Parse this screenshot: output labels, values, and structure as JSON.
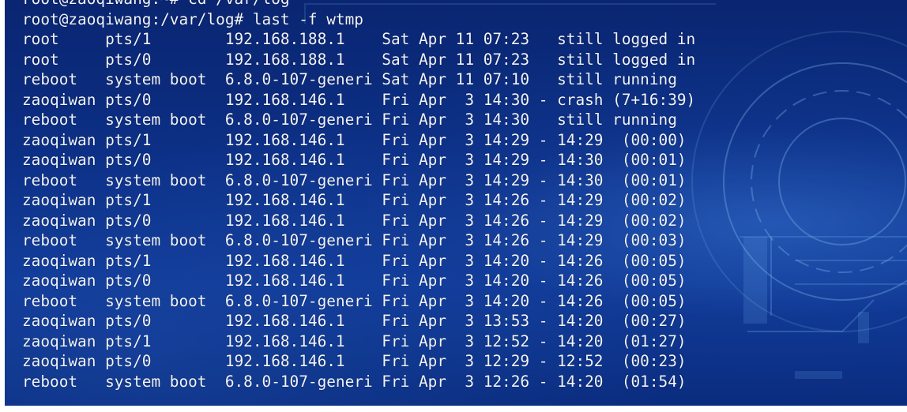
{
  "terminal": {
    "lines": [
      "root@zaoqiwang:~# cd /var/log",
      "root@zaoqiwang:/var/log# last -f wtmp",
      "root     pts/1        192.168.188.1    Sat Apr 11 07:23   still logged in",
      "root     pts/0        192.168.188.1    Sat Apr 11 07:23   still logged in",
      "reboot   system boot  6.8.0-107-generi Sat Apr 11 07:10   still running",
      "zaoqiwan pts/0        192.168.146.1    Fri Apr  3 14:30 - crash (7+16:39)",
      "reboot   system boot  6.8.0-107-generi Fri Apr  3 14:30   still running",
      "zaoqiwan pts/1        192.168.146.1    Fri Apr  3 14:29 - 14:29  (00:00)",
      "zaoqiwan pts/0        192.168.146.1    Fri Apr  3 14:29 - 14:30  (00:01)",
      "reboot   system boot  6.8.0-107-generi Fri Apr  3 14:29 - 14:30  (00:01)",
      "zaoqiwan pts/1        192.168.146.1    Fri Apr  3 14:26 - 14:29  (00:02)",
      "zaoqiwan pts/0        192.168.146.1    Fri Apr  3 14:26 - 14:29  (00:02)",
      "reboot   system boot  6.8.0-107-generi Fri Apr  3 14:26 - 14:29  (00:03)",
      "zaoqiwan pts/1        192.168.146.1    Fri Apr  3 14:20 - 14:26  (00:05)",
      "zaoqiwan pts/0        192.168.146.1    Fri Apr  3 14:20 - 14:26  (00:05)",
      "reboot   system boot  6.8.0-107-generi Fri Apr  3 14:20 - 14:26  (00:05)",
      "zaoqiwan pts/0        192.168.146.1    Fri Apr  3 13:53 - 14:20  (00:27)",
      "zaoqiwan pts/1        192.168.146.1    Fri Apr  3 12:52 - 14:20  (01:27)",
      "zaoqiwan pts/0        192.168.146.1    Fri Apr  3 12:29 - 12:52  (00:23)",
      "reboot   system boot  6.8.0-107-generi Fri Apr  3 12:26 - 14:20  (01:54)"
    ]
  }
}
